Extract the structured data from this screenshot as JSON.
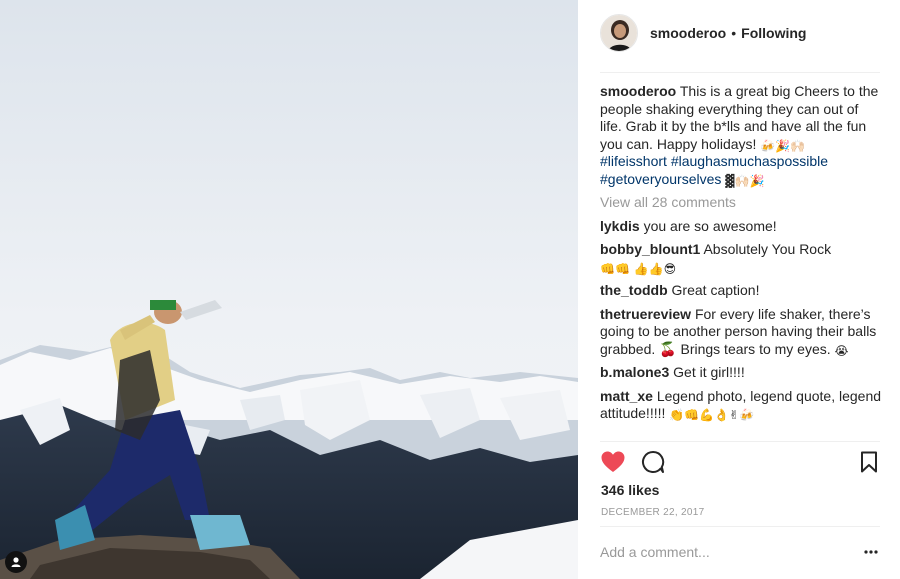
{
  "post": {
    "username": "smooderoo",
    "separator": "•",
    "follow_label": "Following",
    "caption": {
      "username": "smooderoo",
      "text": "This is a great big Cheers to the people shaking everything they can out of life. Grab it by the b*lls and have all the fun you can. Happy holidays!",
      "emojis_1": "🍻🎉🙌🏻",
      "hashtag_1": "#lifeisshort",
      "hashtag_2": "#laughasmuchaspossible",
      "hashtag_3": "#getoveryourselves",
      "emojis_2": "▓🙌🏻🎉"
    },
    "view_all": "View all 28 comments",
    "comments": [
      {
        "user": "lykdis",
        "text": "you are so awesome!",
        "emoji": ""
      },
      {
        "user": "bobby_blount1",
        "text": "Absolutely You Rock",
        "emoji": "👊👊 👍👍😎"
      },
      {
        "user": "the_toddb",
        "text": "Great caption!",
        "emoji": ""
      },
      {
        "user": "thetruereview",
        "text": "For every life shaker, there’s going to be another person having their balls grabbed. 🍒 Brings tears to my eyes.",
        "emoji": "😭"
      },
      {
        "user": "b.malone3",
        "text": "Get it girl!!!!",
        "emoji": ""
      },
      {
        "user": "matt_xe",
        "text": "Legend photo, legend quote, legend attitude!!!!!",
        "emoji": "👏👊💪👌✌🍻"
      }
    ],
    "likes": "346 likes",
    "date": "December 22, 2017",
    "add_comment_placeholder": "Add a comment...",
    "colors": {
      "like_red": "#ed4956",
      "hashtag_blue": "#003569",
      "muted": "#999999",
      "text": "#262626"
    },
    "icons": {
      "like": "heart-icon",
      "comment": "comment-bubble-icon",
      "save": "bookmark-icon",
      "more": "more-options-icon",
      "user_tag": "user-tag-icon"
    }
  }
}
